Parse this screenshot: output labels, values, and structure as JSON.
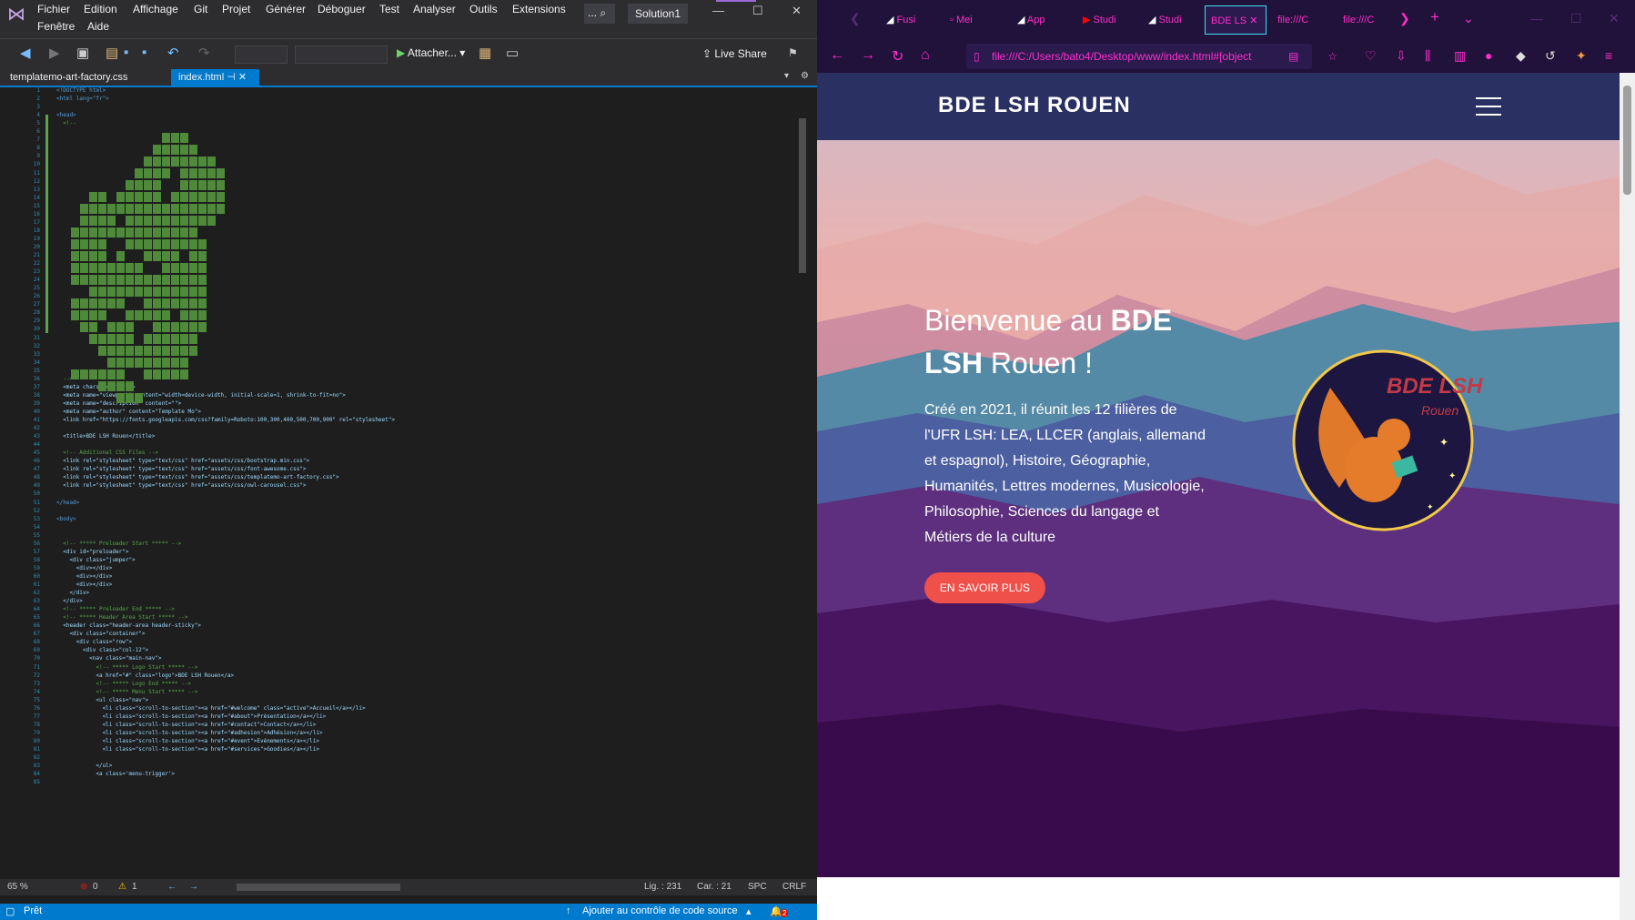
{
  "vs": {
    "menu": [
      "Fichier",
      "Edition",
      "Affichage",
      "Git",
      "Projet",
      "Générer",
      "Déboguer",
      "Test",
      "Analyser",
      "Outils",
      "Extensions",
      "Fenêtre",
      "Aide"
    ],
    "search_label": "...",
    "solution": "Solution1",
    "toolbar": {
      "attach_label": "Attacher...",
      "liveshare_label": "Live Share"
    },
    "tabs": [
      {
        "label": "templatemo-art-factory.css"
      },
      {
        "label": "index.html"
      }
    ],
    "code_lines": [
      {
        "t": "<!DOCTYPE html>",
        "k": "tg"
      },
      {
        "t": "<html lang=\"fr\">",
        "k": "tg"
      },
      {
        "t": "",
        "k": ""
      },
      {
        "t": "<head>",
        "k": "tg"
      },
      {
        "t": "  <!--",
        "k": "cm"
      },
      {
        "t": "  -->",
        "k": "cm"
      },
      {
        "t": "  <meta charset=\"utf-8\">",
        "k": ""
      },
      {
        "t": "  <meta name=\"viewport\" content=\"width=device-width, initial-scale=1, shrink-to-fit=no\">",
        "k": ""
      },
      {
        "t": "  <meta name=\"description\" content=\"\">",
        "k": ""
      },
      {
        "t": "  <meta name=\"author\" content=\"Template Mo\">",
        "k": ""
      },
      {
        "t": "  <link href=\"https://fonts.googleapis.com/css?family=Roboto:100,300,400,500,700,900\" rel=\"stylesheet\">",
        "k": ""
      },
      {
        "t": "",
        "k": ""
      },
      {
        "t": "  <title>BDE LSH Rouen</title>",
        "k": ""
      },
      {
        "t": "",
        "k": ""
      },
      {
        "t": "  <!-- Additional CSS Files -->",
        "k": "cm"
      },
      {
        "t": "  <link rel=\"stylesheet\" type=\"text/css\" href=\"assets/css/bootstrap.min.css\">",
        "k": ""
      },
      {
        "t": "  <link rel=\"stylesheet\" type=\"text/css\" href=\"assets/css/font-awesome.css\">",
        "k": ""
      },
      {
        "t": "  <link rel=\"stylesheet\" type=\"text/css\" href=\"assets/css/templatemo-art-factory.css\">",
        "k": ""
      },
      {
        "t": "  <link rel=\"stylesheet\" type=\"text/css\" href=\"assets/css/owl-carousel.css\">",
        "k": ""
      },
      {
        "t": "",
        "k": ""
      },
      {
        "t": "</head>",
        "k": "tg"
      },
      {
        "t": "",
        "k": ""
      },
      {
        "t": "<body>",
        "k": "tg"
      },
      {
        "t": "",
        "k": ""
      },
      {
        "t": "",
        "k": ""
      },
      {
        "t": "  <!-- ***** Preloader Start ***** -->",
        "k": "cm"
      },
      {
        "t": "  <div id=\"preloader\">",
        "k": ""
      },
      {
        "t": "    <div class=\"jumper\">",
        "k": ""
      },
      {
        "t": "      <div></div>",
        "k": ""
      },
      {
        "t": "      <div></div>",
        "k": ""
      },
      {
        "t": "      <div></div>",
        "k": ""
      },
      {
        "t": "    </div>",
        "k": ""
      },
      {
        "t": "  </div>",
        "k": ""
      },
      {
        "t": "  <!-- ***** Preloader End ***** -->",
        "k": "cm"
      },
      {
        "t": "  <!-- ***** Header Area Start ***** -->",
        "k": "cm"
      },
      {
        "t": "  <header class=\"header-area header-sticky\">",
        "k": ""
      },
      {
        "t": "    <div class=\"container\">",
        "k": ""
      },
      {
        "t": "      <div class=\"row\">",
        "k": ""
      },
      {
        "t": "        <div class=\"col-12\">",
        "k": ""
      },
      {
        "t": "          <nav class=\"main-nav\">",
        "k": ""
      },
      {
        "t": "            <!-- ***** Logo Start ***** -->",
        "k": "cm"
      },
      {
        "t": "            <a href=\"#\" class=\"logo\">BDE LSH Rouen</a>",
        "k": ""
      },
      {
        "t": "            <!-- ***** Logo End ***** -->",
        "k": "cm"
      },
      {
        "t": "            <!-- ***** Menu Start ***** -->",
        "k": "cm"
      },
      {
        "t": "            <ul class=\"nav\">",
        "k": ""
      },
      {
        "t": "              <li class=\"scroll-to-section\"><a href=\"#welcome\" class=\"active\">Accueil</a></li>",
        "k": ""
      },
      {
        "t": "              <li class=\"scroll-to-section\"><a href=\"#about\">Présentation</a></li>",
        "k": ""
      },
      {
        "t": "              <li class=\"scroll-to-section\"><a href=\"#contact\">Contact</a></li>",
        "k": ""
      },
      {
        "t": "              <li class=\"scroll-to-section\"><a href=\"#adhesion\">Adhésion</a></li>",
        "k": ""
      },
      {
        "t": "              <li class=\"scroll-to-section\"><a href=\"#event\">Evénements</a></li>",
        "k": ""
      },
      {
        "t": "              <li class=\"scroll-to-section\"><a href=\"#services\">Goodies</a></li>",
        "k": ""
      },
      {
        "t": "",
        "k": ""
      },
      {
        "t": "            </ul>",
        "k": ""
      },
      {
        "t": "            <a class='menu-trigger'>",
        "k": ""
      }
    ],
    "editor_status": {
      "zoom": "65 %",
      "errors": "0",
      "warnings": "1",
      "line": "Lig. : 231",
      "col": "Car. : 21",
      "spc": "SPC",
      "crlf": "CRLF"
    },
    "statusbar": {
      "ready": "Prêt",
      "source_control": "Ajouter au contrôle de code source",
      "notifications": "2"
    }
  },
  "firefox": {
    "tabs": [
      {
        "label": "Fusi"
      },
      {
        "label": "Mei"
      },
      {
        "label": "App"
      },
      {
        "label": "Studi"
      },
      {
        "label": "Studi"
      },
      {
        "label": "BDE LS"
      },
      {
        "label": "file:///C"
      },
      {
        "label": "file:///C"
      }
    ],
    "url": "file:///C:/Users/bato4/Desktop/www/index.html#[object",
    "accent": "#ff2ecb"
  },
  "site": {
    "logo": "BDE LSH ROUEN",
    "hero": {
      "title_pre": "Bienvenue au ",
      "title_bold": "BDE LSH",
      "title_post": " Rouen !",
      "description": "Créé en 2021, il réunit les 12 filières de l'UFR LSH: LEA, LLCER (anglais, allemand et espagnol), Histoire, Géographie, Humanités, Lettres modernes, Musicologie, Philosophie, Sciences du langage et Métiers de la culture",
      "button": "EN SAVOIR PLUS",
      "logo_text_1": "BDE LSH",
      "logo_text_2": "Rouen"
    },
    "colors": {
      "header": "#2a3162",
      "button": "#f0504a"
    }
  }
}
